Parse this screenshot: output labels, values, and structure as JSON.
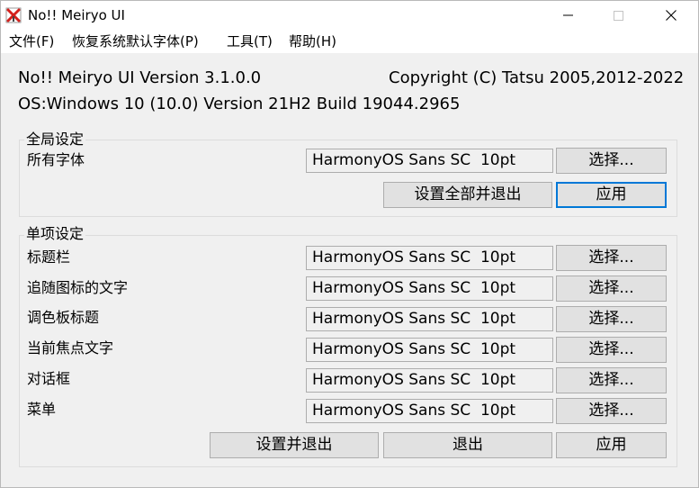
{
  "window": {
    "title": "No!! Meiryo UI",
    "icon": "app-icon-red-x",
    "controls": [
      "minimize-icon",
      "maximize-icon",
      "close-icon"
    ]
  },
  "menu": [
    "文件(F)",
    "恢复系统默认字体(P)",
    "工具(T)",
    "帮助(H)"
  ],
  "info": {
    "version": "No!! Meiryo UI Version 3.1.0.0",
    "copyright": "Copyright (C) Tatsu 2005,2012-2022",
    "os": "OS:Windows 10 (10.0) Version 21H2 Build 19044.2965"
  },
  "global": {
    "title": "全局设定",
    "label": "所有字体",
    "font": "HarmonyOS Sans SC  10pt",
    "choose_label": "选择...",
    "set_all_exit_label": "设置全部并退出",
    "apply_label": "应用"
  },
  "single": {
    "title": "单项设定",
    "rows": [
      {
        "label": "标题栏",
        "font": "HarmonyOS Sans SC  10pt",
        "choose_label": "选择..."
      },
      {
        "label": "追随图标的文字",
        "font": "HarmonyOS Sans SC  10pt",
        "choose_label": "选择..."
      },
      {
        "label": "调色板标题",
        "font": "HarmonyOS Sans SC  10pt",
        "choose_label": "选择..."
      },
      {
        "label": "当前焦点文字",
        "font": "HarmonyOS Sans SC  10pt",
        "choose_label": "选择..."
      },
      {
        "label": "对话框",
        "font": "HarmonyOS Sans SC  10pt",
        "choose_label": "选择..."
      },
      {
        "label": "菜单",
        "font": "HarmonyOS Sans SC  10pt",
        "choose_label": "选择..."
      }
    ],
    "set_exit_label": "设置并退出",
    "exit_label": "退出",
    "apply_label": "应用"
  },
  "colors": {
    "default_button_border": "#0078d7",
    "window_bg": "#f0f0f0",
    "button_bg": "#e1e1e1"
  }
}
